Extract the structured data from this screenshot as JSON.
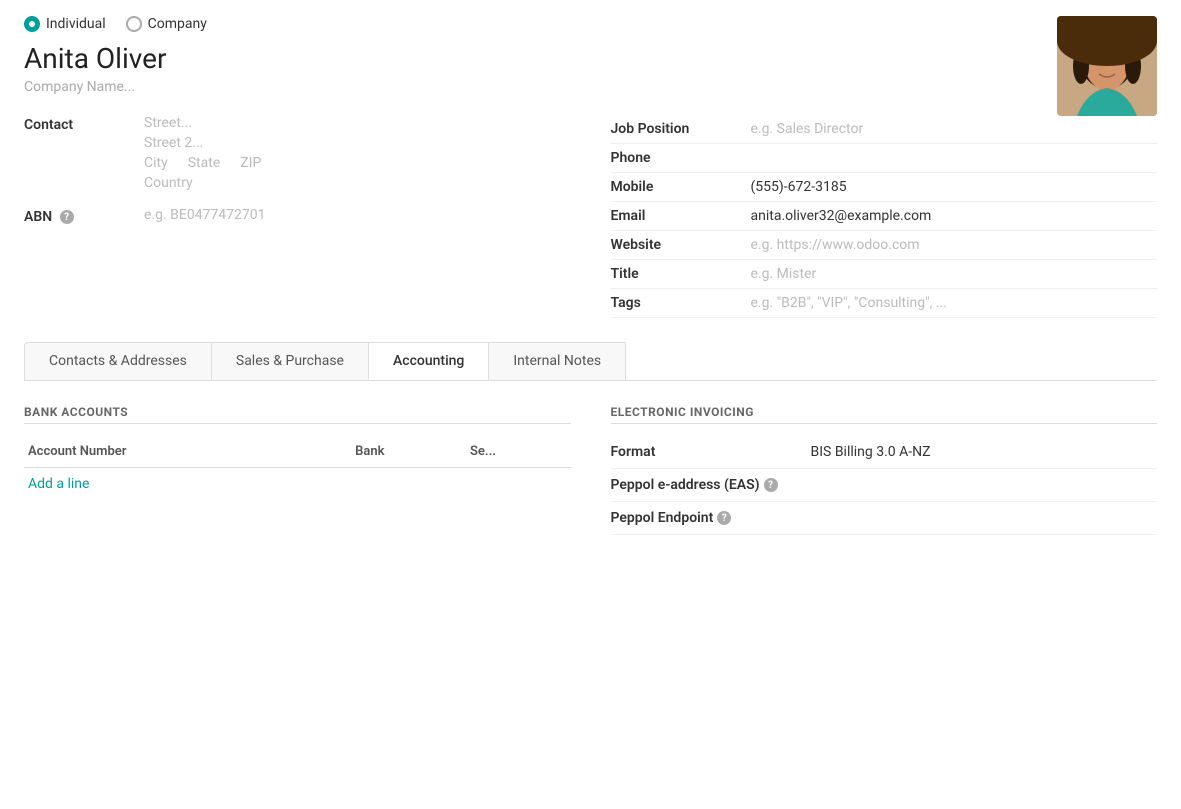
{
  "radio": {
    "individual_label": "Individual",
    "company_label": "Company",
    "selected": "individual"
  },
  "contact": {
    "name": "Anita Oliver",
    "company_name_placeholder": "Company Name...",
    "avatar_alt": "Anita Oliver photo"
  },
  "left_form": {
    "contact_label": "Contact",
    "street_placeholder": "Street...",
    "street2_placeholder": "Street 2...",
    "city_placeholder": "City",
    "state_placeholder": "State",
    "zip_placeholder": "ZIP",
    "country_placeholder": "Country",
    "abn_label": "ABN",
    "abn_help": "?",
    "abn_placeholder": "e.g. BE0477472701"
  },
  "right_form": {
    "fields": [
      {
        "label": "Job Position",
        "value": "",
        "placeholder": "e.g. Sales Director"
      },
      {
        "label": "Phone",
        "value": "",
        "placeholder": ""
      },
      {
        "label": "Mobile",
        "value": "(555)-672-3185",
        "placeholder": ""
      },
      {
        "label": "Email",
        "value": "anita.oliver32@example.com",
        "placeholder": ""
      },
      {
        "label": "Website",
        "value": "",
        "placeholder": "e.g. https://www.odoo.com"
      },
      {
        "label": "Title",
        "value": "",
        "placeholder": "e.g. Mister"
      },
      {
        "label": "Tags",
        "value": "",
        "placeholder": "e.g. \"B2B\", \"VIP\", \"Consulting\", ..."
      }
    ]
  },
  "tabs": [
    {
      "id": "contacts",
      "label": "Contacts & Addresses",
      "active": false
    },
    {
      "id": "sales",
      "label": "Sales & Purchase",
      "active": false
    },
    {
      "id": "accounting",
      "label": "Accounting",
      "active": true
    },
    {
      "id": "notes",
      "label": "Internal Notes",
      "active": false
    }
  ],
  "bank_accounts": {
    "section_title": "BANK ACCOUNTS",
    "columns": [
      "Account Number",
      "Bank",
      "Se..."
    ],
    "rows": [],
    "add_line_label": "Add a line"
  },
  "electronic_invoicing": {
    "section_title": "ELECTRONIC INVOICING",
    "fields": [
      {
        "label": "Format",
        "value": "BIS Billing 3.0 A-NZ",
        "has_help": false
      },
      {
        "label": "Peppol e-address (EAS)",
        "value": "",
        "has_help": true
      },
      {
        "label": "Peppol Endpoint",
        "value": "",
        "has_help": true
      }
    ]
  }
}
